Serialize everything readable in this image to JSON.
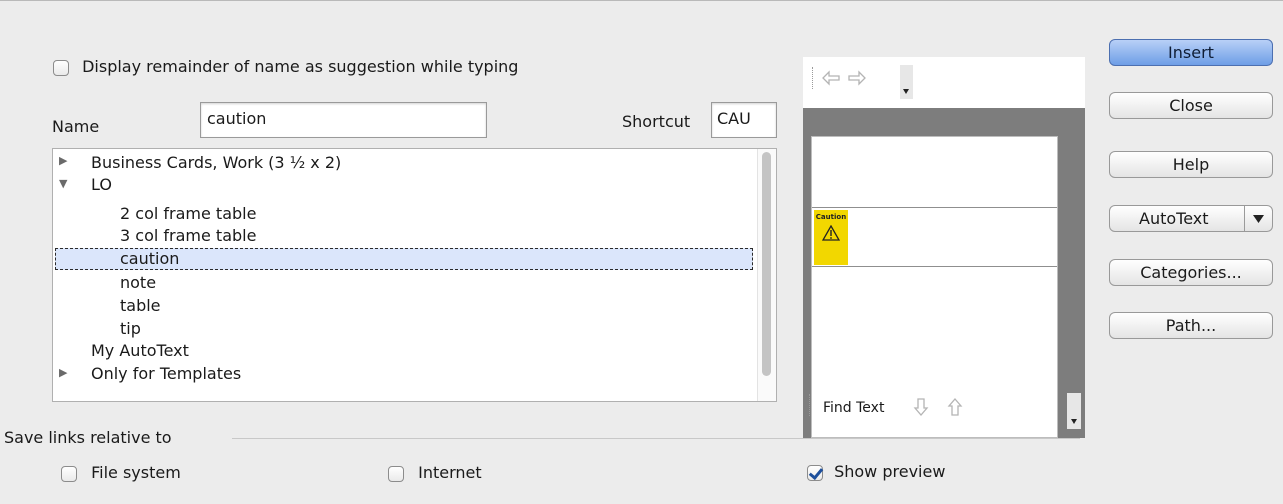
{
  "options": {
    "display_remainder_label": "Display remainder of name as suggestion while typing"
  },
  "fields": {
    "name_label": "Name",
    "name_value": "caution",
    "shortcut_label": "Shortcut",
    "shortcut_value": "CAU"
  },
  "tree": {
    "items": [
      {
        "label": "Business Cards, Work (3 ½ x 2)",
        "expanded": false
      },
      {
        "label": "LO",
        "expanded": true
      },
      {
        "label": "2 col frame table"
      },
      {
        "label": "3 col frame table"
      },
      {
        "label": "caution",
        "selected": true
      },
      {
        "label": "note"
      },
      {
        "label": "table"
      },
      {
        "label": "tip"
      },
      {
        "label": "My AutoText"
      },
      {
        "label": "Only for Templates",
        "expanded": false
      }
    ]
  },
  "preview": {
    "prev_icon": "arrow-left-icon",
    "next_icon": "arrow-right-icon",
    "find_text_label": "Find Text",
    "caution_graphic_text": "Caution",
    "warning_icon": "warning-triangle-icon"
  },
  "buttons": {
    "insert": "Insert",
    "close": "Close",
    "help": "Help",
    "autotext": "AutoText",
    "categories": "Categories...",
    "path": "Path..."
  },
  "save_links": {
    "title": "Save links relative to",
    "file_system": "File system",
    "internet": "Internet"
  },
  "show_preview": {
    "label": "Show preview",
    "checked": true
  },
  "colors": {
    "selection": "#dbe6fb",
    "default_button": "#6e9ee6",
    "caution_yellow": "#f2d700"
  }
}
